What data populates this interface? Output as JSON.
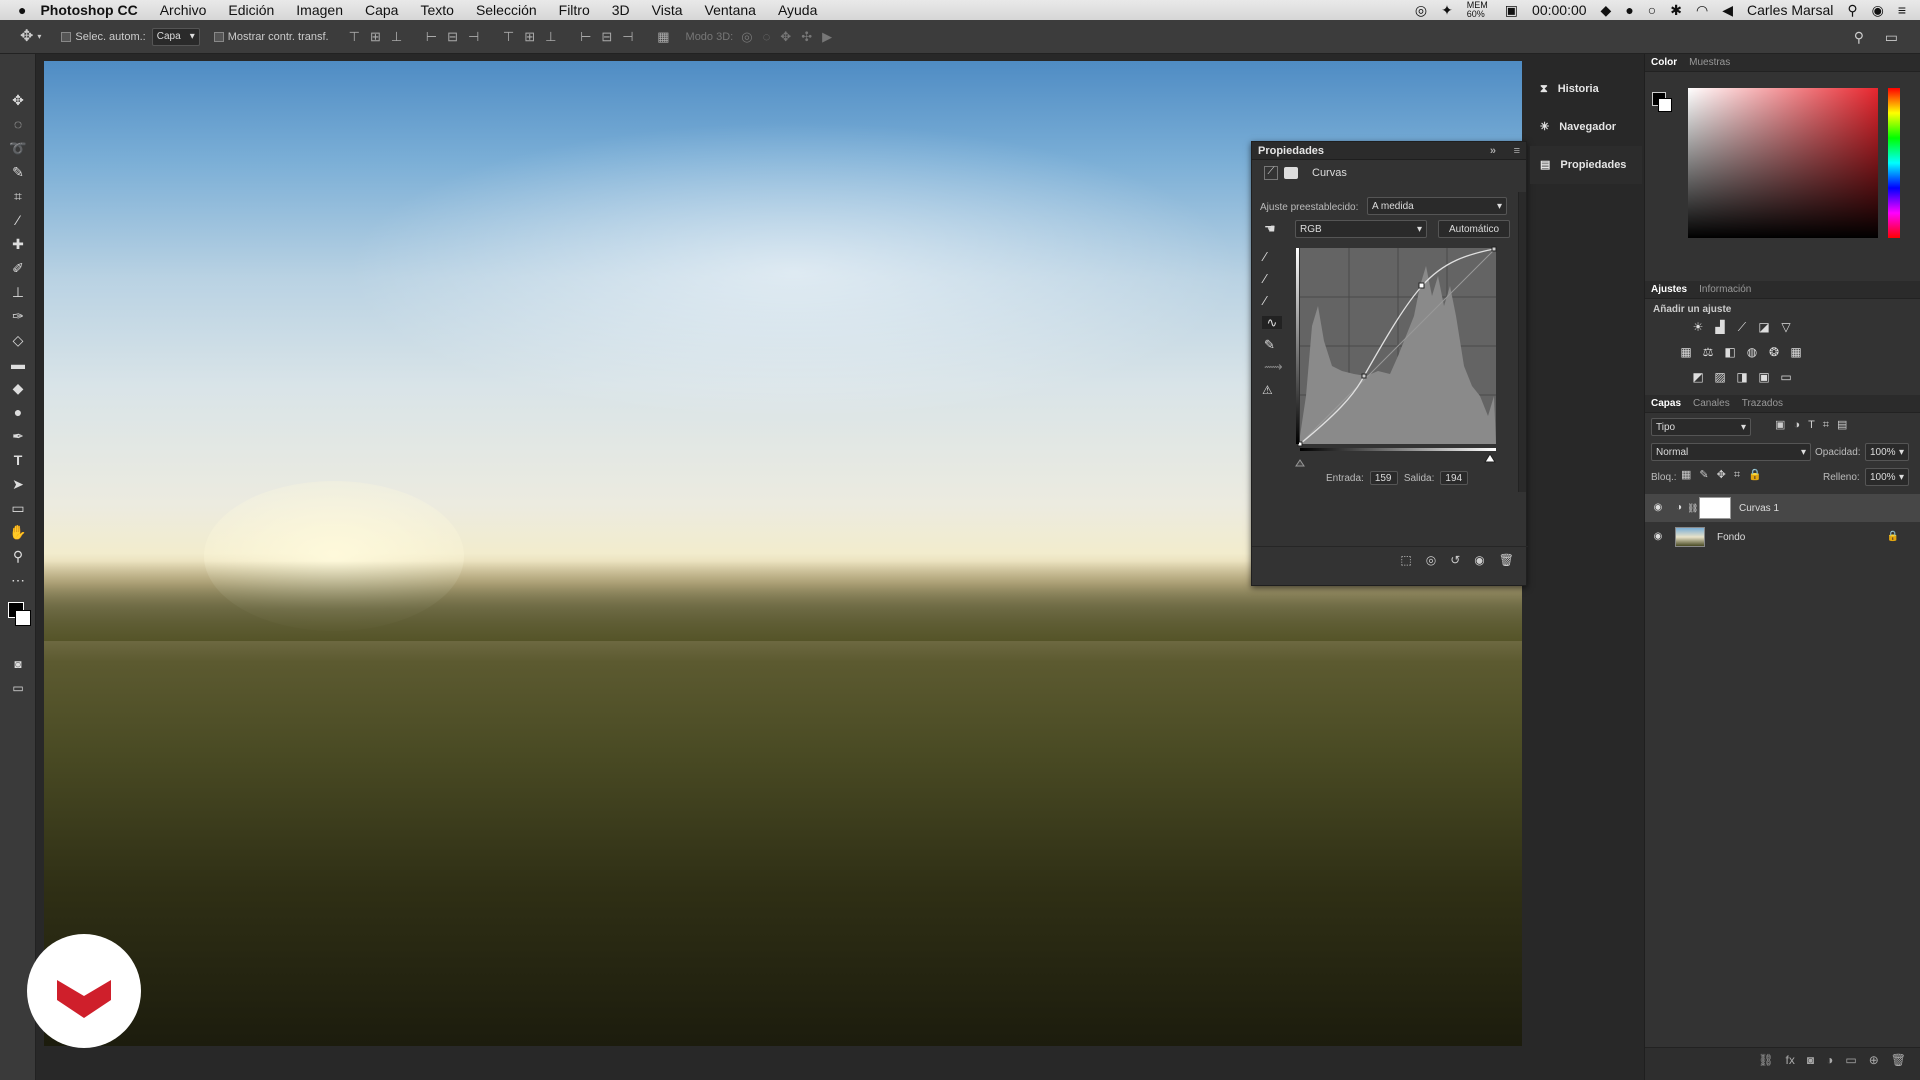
{
  "menubar": {
    "app": "Photoshop CC",
    "items": [
      "Archivo",
      "Edición",
      "Imagen",
      "Capa",
      "Texto",
      "Selección",
      "Filtro",
      "3D",
      "Vista",
      "Ventana",
      "Ayuda"
    ],
    "battery": "MEM 60%",
    "clock": "00:00:00",
    "user": "Carles Marsal"
  },
  "options": {
    "auto_select": "Selec. autom.:",
    "target": "Capa",
    "show_transform": "Mostrar contr. transf.",
    "mode3d": "Modo 3D:"
  },
  "properties": {
    "title": "Propiedades",
    "section": "Curvas",
    "preset_label": "Ajuste preestablecido:",
    "preset_value": "A medida",
    "channel": "RGB",
    "auto_button": "Automático",
    "input_label": "Entrada:",
    "input_value": "159",
    "output_label": "Salida:",
    "output_value": "194"
  },
  "side_panels": {
    "history": "Historia",
    "navigator": "Navegador",
    "properties": "Propiedades"
  },
  "color_tabs": {
    "color": "Color",
    "swatches": "Muestras"
  },
  "adjust_tabs": {
    "adjustments": "Ajustes",
    "info": "Información",
    "add": "Añadir un ajuste"
  },
  "layers_tabs": {
    "layers": "Capas",
    "channels": "Canales",
    "paths": "Trazados"
  },
  "layers": {
    "filter": "Tipo",
    "blend": "Normal",
    "opacity_label": "Opacidad:",
    "opacity": "100%",
    "lock_label": "Bloq.:",
    "fill_label": "Relleno:",
    "fill": "100%",
    "items": [
      {
        "name": "Curvas 1"
      },
      {
        "name": "Fondo"
      }
    ]
  },
  "colors": {
    "accent": "#cf1f2b"
  }
}
